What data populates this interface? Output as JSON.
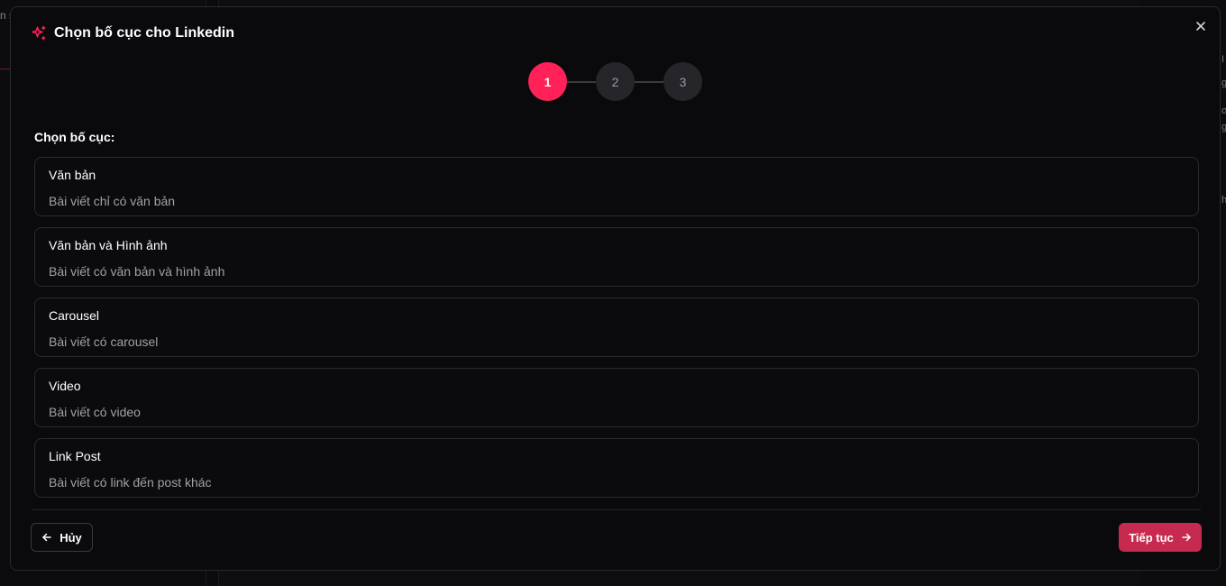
{
  "background": {
    "left_fragment": "n s",
    "right_fragments": [
      "I",
      "g",
      "or",
      "g",
      "h"
    ]
  },
  "modal": {
    "title": "Chọn bố cục cho Linkedin",
    "icon": "sparkles-icon",
    "close_icon": "close-icon",
    "accent_color": "#ff2158"
  },
  "stepper": {
    "steps": [
      {
        "label": "1",
        "state": "active"
      },
      {
        "label": "2",
        "state": "inactive"
      },
      {
        "label": "3",
        "state": "inactive"
      }
    ]
  },
  "section_label": "Chọn bố cục:",
  "options": [
    {
      "title": "Văn bản",
      "description": "Bài viết chỉ có văn bản"
    },
    {
      "title": "Văn bản và Hình ảnh",
      "description": "Bài viết có văn bản và hình ảnh"
    },
    {
      "title": "Carousel",
      "description": "Bài viết có carousel"
    },
    {
      "title": "Video",
      "description": "Bài viết có video"
    },
    {
      "title": "Link Post",
      "description": "Bài viết có link đến post khác"
    }
  ],
  "footer": {
    "cancel_label": "Hủy",
    "next_label": "Tiếp tục",
    "next_color": "#c62a4f"
  }
}
